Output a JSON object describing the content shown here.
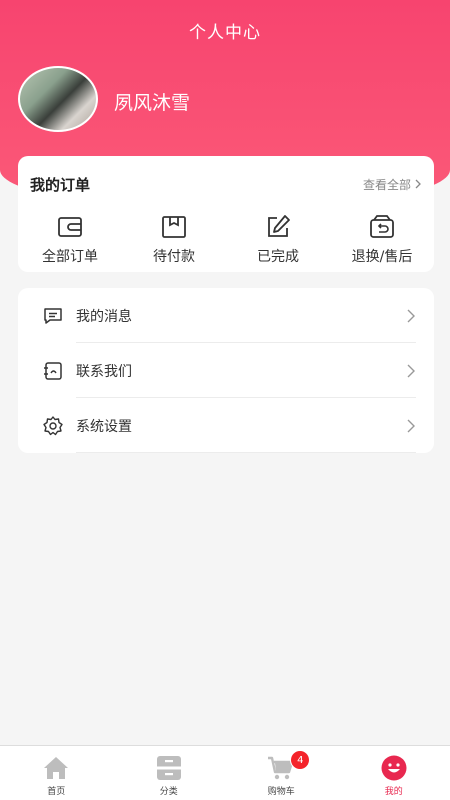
{
  "header": {
    "title": "个人中心",
    "username": "夙风沐雪",
    "accent_color": "#f7446f"
  },
  "orders": {
    "title": "我的订单",
    "view_all": "查看全部",
    "items": [
      {
        "label": "全部订单",
        "icon": "wallet-icon"
      },
      {
        "label": "待付款",
        "icon": "box-icon"
      },
      {
        "label": "已完成",
        "icon": "edit-icon"
      },
      {
        "label": "退换/售后",
        "icon": "return-icon"
      }
    ]
  },
  "menu": {
    "items": [
      {
        "label": "我的消息",
        "icon": "message-icon"
      },
      {
        "label": "联系我们",
        "icon": "contact-icon"
      },
      {
        "label": "系统设置",
        "icon": "gear-icon"
      }
    ]
  },
  "tabbar": {
    "items": [
      {
        "label": "首页",
        "icon": "home-icon"
      },
      {
        "label": "分类",
        "icon": "category-icon"
      },
      {
        "label": "购物车",
        "icon": "cart-icon"
      },
      {
        "label": "我的",
        "icon": "profile-icon"
      }
    ],
    "cart_badge": "4",
    "active_color": "#e8284f"
  }
}
